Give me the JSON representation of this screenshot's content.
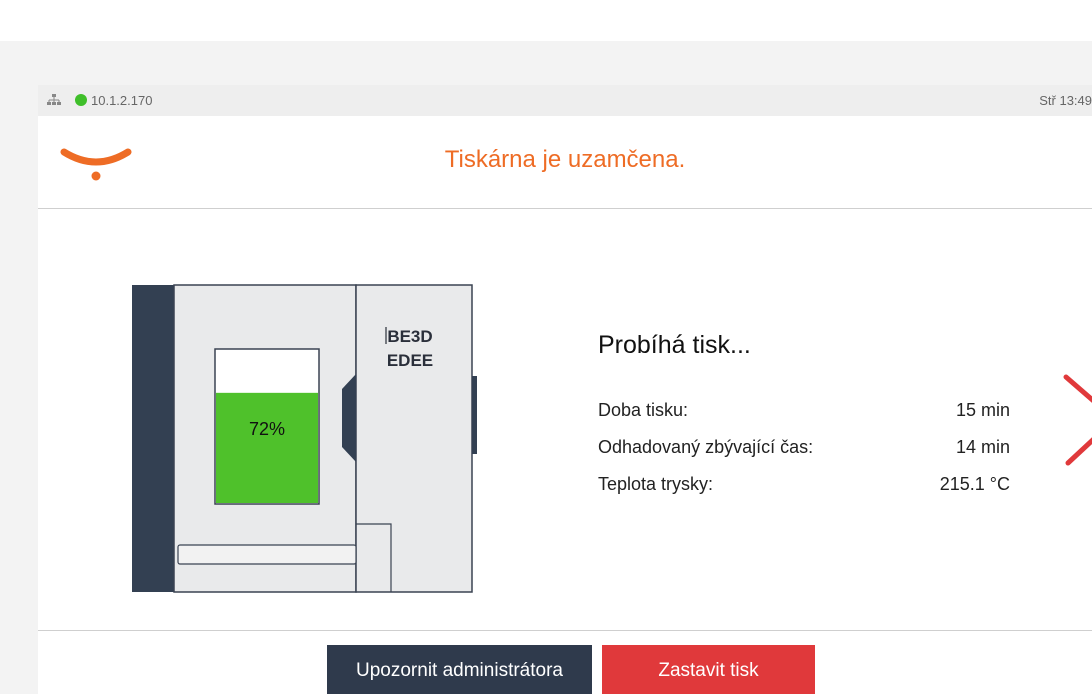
{
  "statusbar": {
    "ip": "10.1.2.170",
    "clock": "Stř 13:49",
    "network_icon": "network-icon",
    "connection_color": "#3fbf2a"
  },
  "header": {
    "title": "Tiskárna je uzamčena.",
    "logo": "be3d-logo",
    "accent": "#ee6c25"
  },
  "printer": {
    "brand_line1": "BE3D",
    "brand_line2": "EDEE",
    "progress": 72,
    "progress_label": "72%",
    "progress_color": "#4fc12b"
  },
  "job": {
    "title": "Probíhá tisk...",
    "rows": [
      {
        "label": "Doba tisku:",
        "value": "15 min"
      },
      {
        "label": "Odhadovaný zbývající čas:",
        "value": "14 min"
      },
      {
        "label": "Teplota trysky:",
        "value": "215.1 °C"
      }
    ]
  },
  "actions": {
    "notify_admin": "Upozornit administrátora",
    "stop_print": "Zastavit tisk",
    "admin_color": "#2f3a4c",
    "stop_color": "#e0393b"
  }
}
